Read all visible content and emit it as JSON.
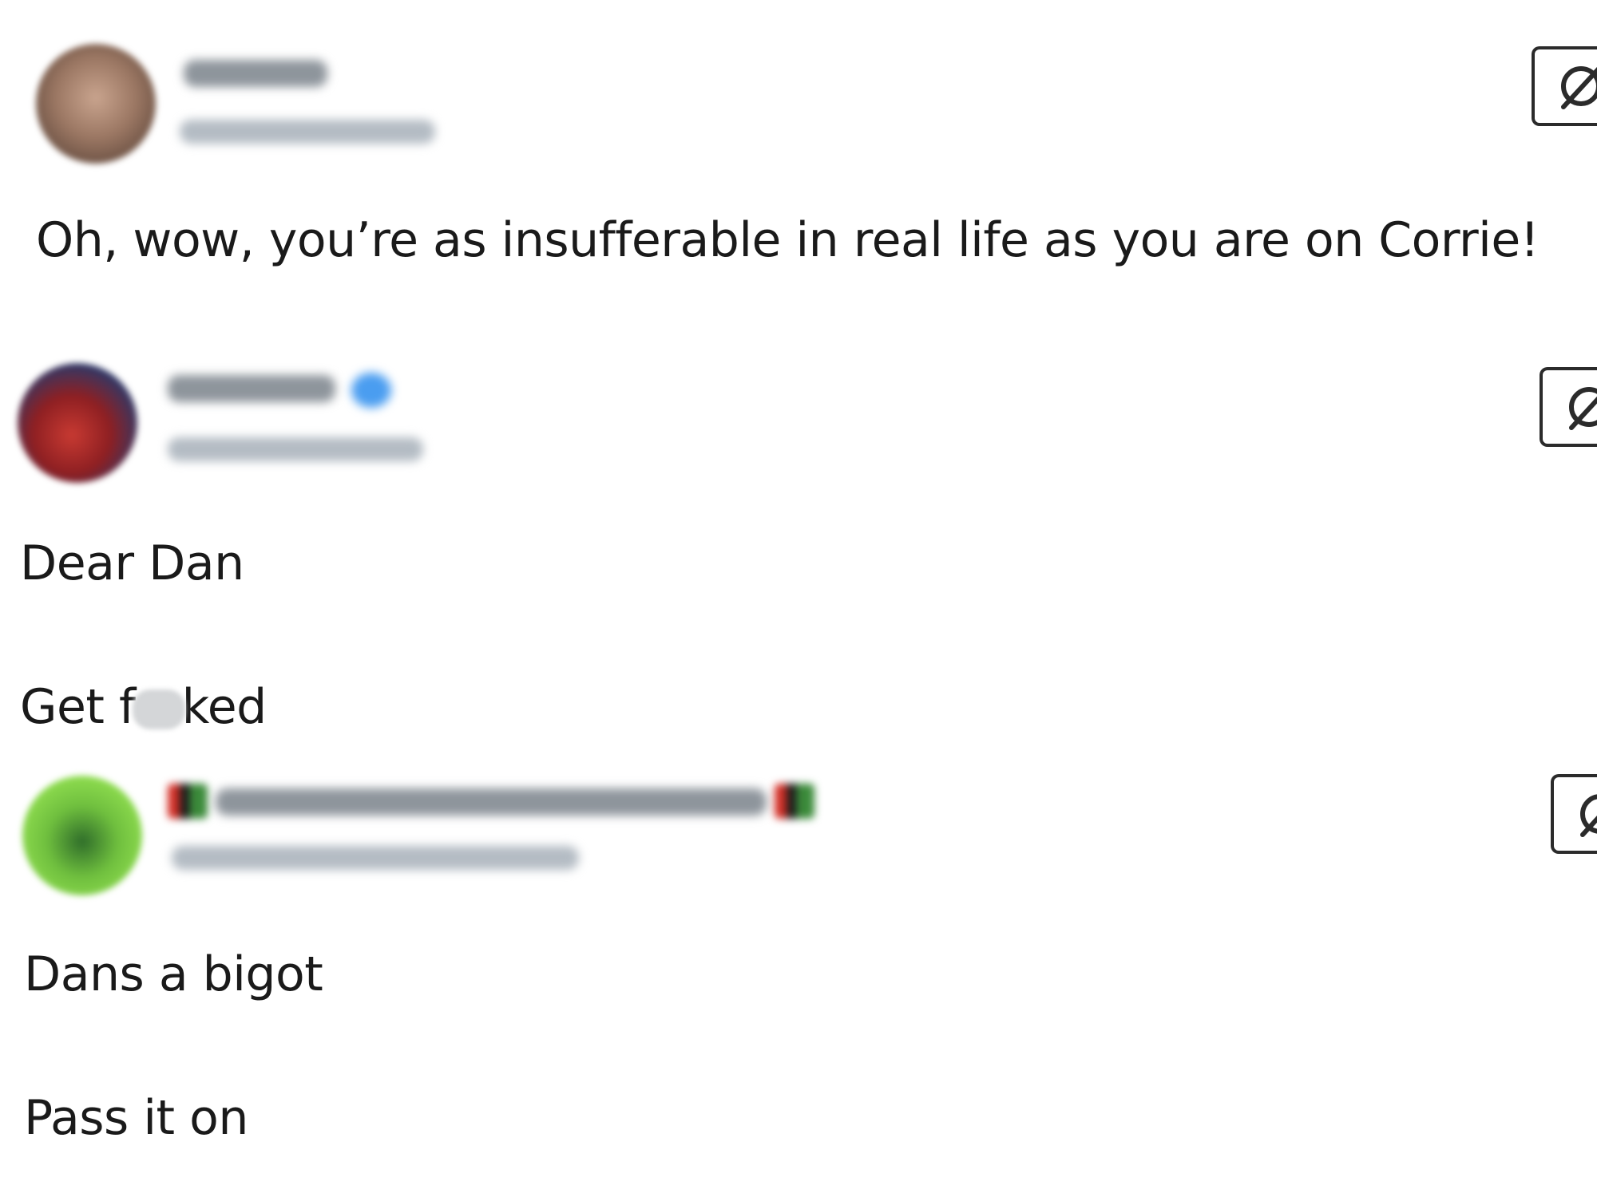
{
  "posts": [
    {
      "avatar": "avatar-photo",
      "display_name_blurred": true,
      "handle_blurred": true,
      "lines": [
        "Oh, wow, you’re as insufferable in real life as you are on Corrie!"
      ],
      "reply_icon": "reply-slash-icon"
    },
    {
      "avatar": "avatar-photo",
      "display_name_blurred": true,
      "handle_blurred": true,
      "verified_badge_blurred": true,
      "lines": [
        "Dear Dan",
        "Get f",
        "ked"
      ],
      "reply_icon": "reply-slash-icon"
    },
    {
      "avatar": "avatar-photo",
      "display_name_blurred": true,
      "handle_blurred": true,
      "flag_emoji_blurred": true,
      "lines": [
        "Dans a bigot",
        "Pass it on"
      ],
      "reply_icon": "reply-slash-icon"
    }
  ],
  "colors": {
    "text": "#1a1a1a",
    "verified_blue": "#4a9df0",
    "background": "#ffffff"
  }
}
